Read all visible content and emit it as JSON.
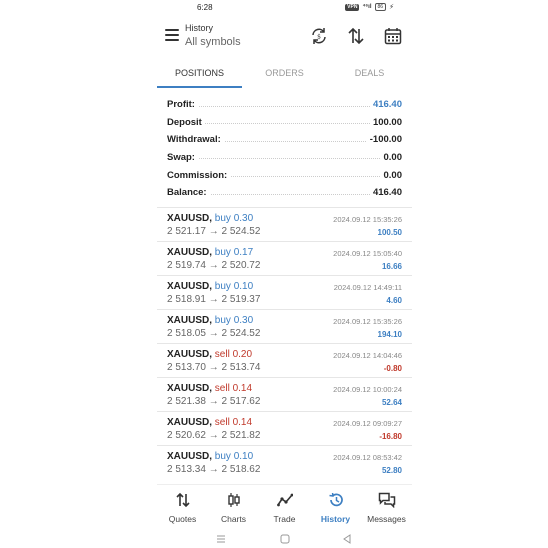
{
  "status_bar": {
    "time": "6:28",
    "vpn": "VPN",
    "signal": "⁴⁶ıl",
    "battery": "86"
  },
  "header": {
    "title": "History",
    "subtitle": "All symbols"
  },
  "tabs": [
    {
      "label": "POSITIONS",
      "active": true
    },
    {
      "label": "ORDERS",
      "active": false
    },
    {
      "label": "DEALS",
      "active": false
    }
  ],
  "summary": [
    {
      "label": "Profit:",
      "value": "416.40"
    },
    {
      "label": "Deposit",
      "value": "100.00"
    },
    {
      "label": "Withdrawal:",
      "value": "-100.00"
    },
    {
      "label": "Swap:",
      "value": "0.00"
    },
    {
      "label": "Commission:",
      "value": "0.00"
    },
    {
      "label": "Balance:",
      "value": "416.40"
    }
  ],
  "deals": [
    {
      "symbol": "XAUUSD,",
      "side": "buy 0.30",
      "prices": "2 521.17 → 2 524.52",
      "datetime": "2024.09.12 15:35:26",
      "profit": "100.50"
    },
    {
      "symbol": "XAUUSD,",
      "side": "buy 0.17",
      "prices": "2 519.74 → 2 520.72",
      "datetime": "2024.09.12 15:05:40",
      "profit": "16.66"
    },
    {
      "symbol": "XAUUSD,",
      "side": "buy 0.10",
      "prices": "2 518.91 → 2 519.37",
      "datetime": "2024.09.12 14:49:11",
      "profit": "4.60"
    },
    {
      "symbol": "XAUUSD,",
      "side": "buy 0.30",
      "prices": "2 518.05 → 2 524.52",
      "datetime": "2024.09.12 15:35:26",
      "profit": "194.10"
    },
    {
      "symbol": "XAUUSD,",
      "side": "sell 0.20",
      "prices": "2 513.70 → 2 513.74",
      "datetime": "2024.09.12 14:04:46",
      "profit": "-0.80"
    },
    {
      "symbol": "XAUUSD,",
      "side": "sell 0.14",
      "prices": "2 521.38 → 2 517.62",
      "datetime": "2024.09.12 10:00:24",
      "profit": "52.64"
    },
    {
      "symbol": "XAUUSD,",
      "side": "sell 0.14",
      "prices": "2 520.62 → 2 521.82",
      "datetime": "2024.09.12 09:09:27",
      "profit": "-16.80"
    },
    {
      "symbol": "XAUUSD,",
      "side": "buy 0.10",
      "prices": "2 513.34 → 2 518.62",
      "datetime": "2024.09.12 08:53:42",
      "profit": "52.80"
    }
  ],
  "bottom_nav": [
    {
      "label": "Quotes",
      "icon": "quotes-icon"
    },
    {
      "label": "Charts",
      "icon": "charts-icon"
    },
    {
      "label": "Trade",
      "icon": "trade-icon"
    },
    {
      "label": "History",
      "icon": "history-icon",
      "active": true
    },
    {
      "label": "Messages",
      "icon": "messages-icon"
    }
  ],
  "colors": {
    "accent": "#3d7fc2",
    "loss": "#c0392b"
  }
}
